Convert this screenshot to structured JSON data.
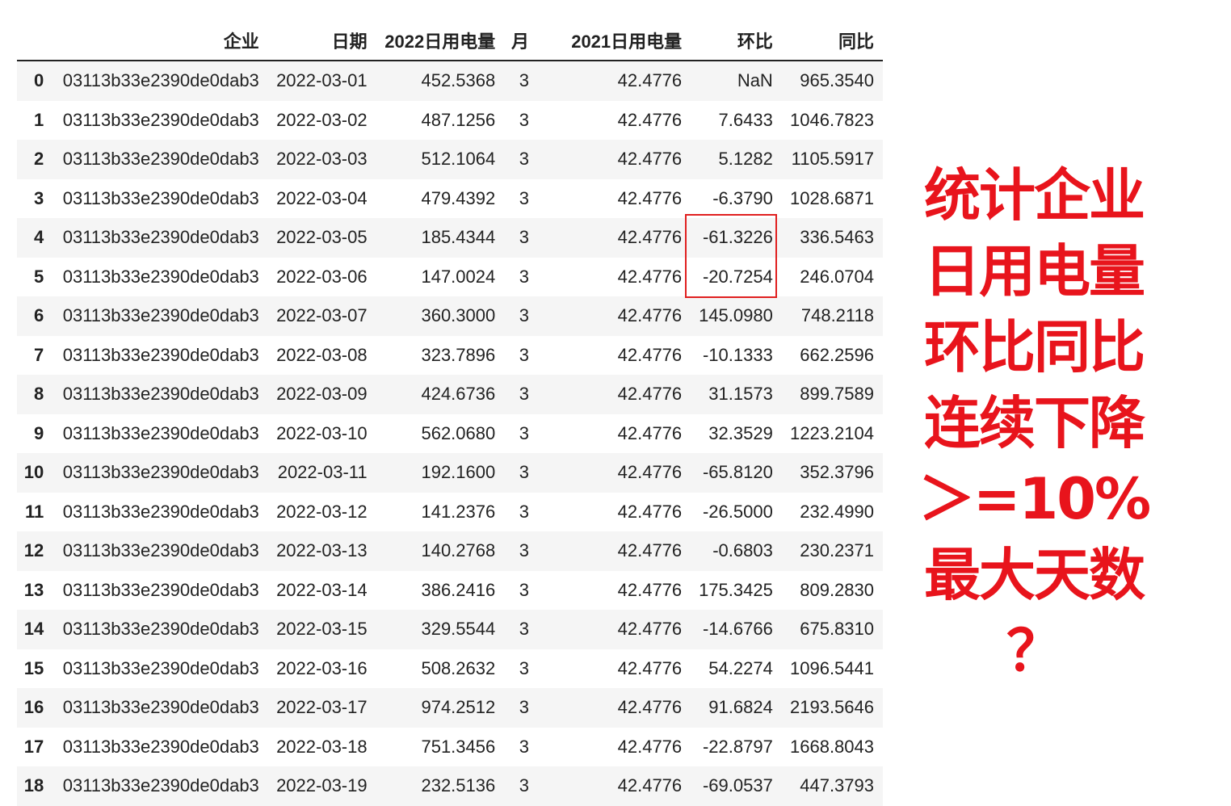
{
  "table": {
    "columns": [
      "",
      "企业",
      "日期",
      "2022日用电量",
      "月",
      "2021日用电量",
      "环比",
      "同比"
    ],
    "rows": [
      [
        "0",
        "03113b33e2390de0dab3",
        "2022-03-01",
        "452.5368",
        "3",
        "42.4776",
        "NaN",
        "965.3540"
      ],
      [
        "1",
        "03113b33e2390de0dab3",
        "2022-03-02",
        "487.1256",
        "3",
        "42.4776",
        "7.6433",
        "1046.7823"
      ],
      [
        "2",
        "03113b33e2390de0dab3",
        "2022-03-03",
        "512.1064",
        "3",
        "42.4776",
        "5.1282",
        "1105.5917"
      ],
      [
        "3",
        "03113b33e2390de0dab3",
        "2022-03-04",
        "479.4392",
        "3",
        "42.4776",
        "-6.3790",
        "1028.6871"
      ],
      [
        "4",
        "03113b33e2390de0dab3",
        "2022-03-05",
        "185.4344",
        "3",
        "42.4776",
        "-61.3226",
        "336.5463"
      ],
      [
        "5",
        "03113b33e2390de0dab3",
        "2022-03-06",
        "147.0024",
        "3",
        "42.4776",
        "-20.7254",
        "246.0704"
      ],
      [
        "6",
        "03113b33e2390de0dab3",
        "2022-03-07",
        "360.3000",
        "3",
        "42.4776",
        "145.0980",
        "748.2118"
      ],
      [
        "7",
        "03113b33e2390de0dab3",
        "2022-03-08",
        "323.7896",
        "3",
        "42.4776",
        "-10.1333",
        "662.2596"
      ],
      [
        "8",
        "03113b33e2390de0dab3",
        "2022-03-09",
        "424.6736",
        "3",
        "42.4776",
        "31.1573",
        "899.7589"
      ],
      [
        "9",
        "03113b33e2390de0dab3",
        "2022-03-10",
        "562.0680",
        "3",
        "42.4776",
        "32.3529",
        "1223.2104"
      ],
      [
        "10",
        "03113b33e2390de0dab3",
        "2022-03-11",
        "192.1600",
        "3",
        "42.4776",
        "-65.8120",
        "352.3796"
      ],
      [
        "11",
        "03113b33e2390de0dab3",
        "2022-03-12",
        "141.2376",
        "3",
        "42.4776",
        "-26.5000",
        "232.4990"
      ],
      [
        "12",
        "03113b33e2390de0dab3",
        "2022-03-13",
        "140.2768",
        "3",
        "42.4776",
        "-0.6803",
        "230.2371"
      ],
      [
        "13",
        "03113b33e2390de0dab3",
        "2022-03-14",
        "386.2416",
        "3",
        "42.4776",
        "175.3425",
        "809.2830"
      ],
      [
        "14",
        "03113b33e2390de0dab3",
        "2022-03-15",
        "329.5544",
        "3",
        "42.4776",
        "-14.6766",
        "675.8310"
      ],
      [
        "15",
        "03113b33e2390de0dab3",
        "2022-03-16",
        "508.2632",
        "3",
        "42.4776",
        "54.2274",
        "1096.5441"
      ],
      [
        "16",
        "03113b33e2390de0dab3",
        "2022-03-17",
        "974.2512",
        "3",
        "42.4776",
        "91.6824",
        "2193.5646"
      ],
      [
        "17",
        "03113b33e2390de0dab3",
        "2022-03-18",
        "751.3456",
        "3",
        "42.4776",
        "-22.8797",
        "1668.8043"
      ],
      [
        "18",
        "03113b33e2390de0dab3",
        "2022-03-19",
        "232.5136",
        "3",
        "42.4776",
        "-69.0537",
        "447.3793"
      ]
    ]
  },
  "annotation": {
    "lines": [
      "统计企业",
      "日用电量",
      "环比同比",
      "连续下降",
      "＞=10%",
      "最大天数",
      "？"
    ],
    "color": "#e8141c"
  },
  "highlight": {
    "color": "#e02020",
    "rows": [
      "4",
      "5"
    ],
    "column": "环比"
  }
}
